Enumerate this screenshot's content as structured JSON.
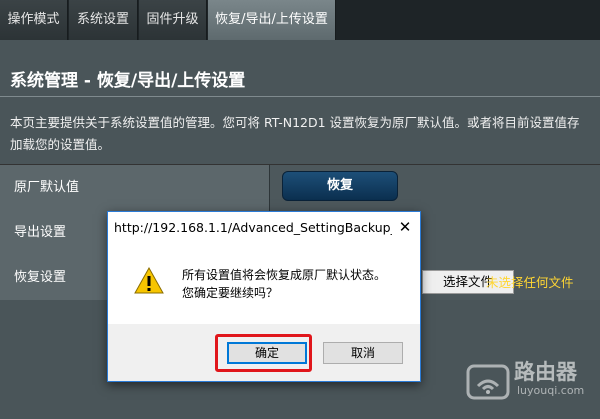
{
  "tabs": [
    {
      "label": "操作模式"
    },
    {
      "label": "系统设置"
    },
    {
      "label": "固件升级"
    },
    {
      "label": "恢复/导出/上传设置",
      "active": true
    }
  ],
  "page": {
    "title": "系统管理 - 恢复/导出/上传设置",
    "description_line1": "本页主要提供关于系统设置值的管理。您可将 RT-N12D1 设置恢复为原厂默认值。或者将目前设置值存",
    "description_line2": "加载您的设置值。"
  },
  "settings": {
    "factory_default_label": "原厂默认值",
    "restore_button": "恢复",
    "export_label": "导出设置",
    "restore_settings_label": "恢复设置",
    "choose_file_button": "选择文件",
    "file_status": "未选择任何文件"
  },
  "dialog": {
    "title": "http://192.168.1.1/Advanced_SettingBackup_C...",
    "close_symbol": "✕",
    "message_line1": "所有设置值将会恢复成原厂默认状态。",
    "message_line2": "您确定要继续吗？",
    "ok_button": "确定",
    "cancel_button": "取消",
    "icon": "warning-icon"
  },
  "watermark": {
    "text": "路由器",
    "url": "luyouqi.com"
  },
  "colors": {
    "highlight": "#e0161b",
    "file_status": "#ffd633",
    "restore_button": "#0b2f4f"
  }
}
